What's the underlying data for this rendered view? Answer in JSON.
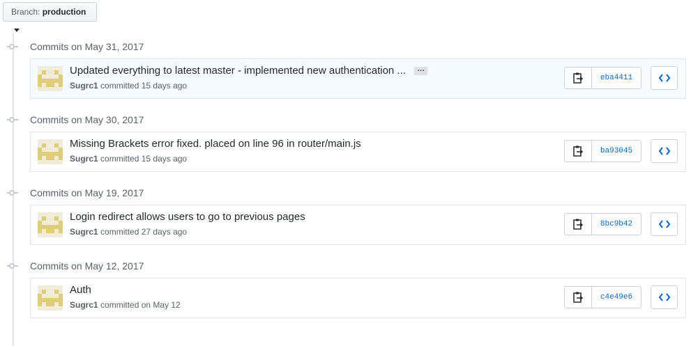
{
  "branch": {
    "label": "Branch:",
    "value": "production"
  },
  "groups": [
    {
      "date": "Commits on May 31, 2017",
      "commit": {
        "message": "Updated everything to latest master - implemented new authentication ...",
        "author": "Sugrc1",
        "when": "committed 15 days ago",
        "sha": "eba4411",
        "has_more": true,
        "more_label": "…"
      }
    },
    {
      "date": "Commits on May 30, 2017",
      "commit": {
        "message": "Missing Brackets error fixed. placed on line 96 in router/main.js",
        "author": "Sugrc1",
        "when": "committed 15 days ago",
        "sha": "ba93045"
      }
    },
    {
      "date": "Commits on May 19, 2017",
      "commit": {
        "message": "Login redirect allows users to go to previous pages",
        "author": "Sugrc1",
        "when": "committed 27 days ago",
        "sha": "8bc9b42"
      }
    },
    {
      "date": "Commits on May 12, 2017",
      "commit": {
        "message": "Auth",
        "author": "Sugrc1",
        "when": "committed on May 12",
        "sha": "c4e49e6"
      }
    }
  ],
  "icons": {
    "clipboard": "clipboard-icon",
    "browse": "code-icon",
    "avatar": "identicon-avatar"
  },
  "colors": {
    "link": "#0366d6",
    "avatar": "#e0cd7a",
    "active_row": "#f6fbff"
  }
}
